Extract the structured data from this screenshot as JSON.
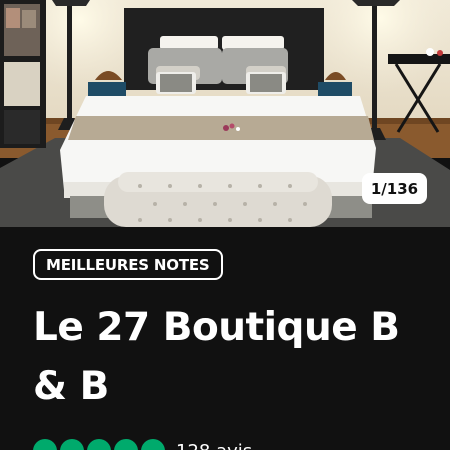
{
  "listing": {
    "photo_counter": "1/136",
    "badge": "MEILLEURES NOTES",
    "name": "Le 27 Boutique B & B",
    "rating_bubbles": 5,
    "review_count_text": "128 avis"
  },
  "colors": {
    "background": "#111111",
    "rating_green": "#00aa6c",
    "text": "#ffffff"
  },
  "icons": [
    "rating-bubble-icon"
  ]
}
